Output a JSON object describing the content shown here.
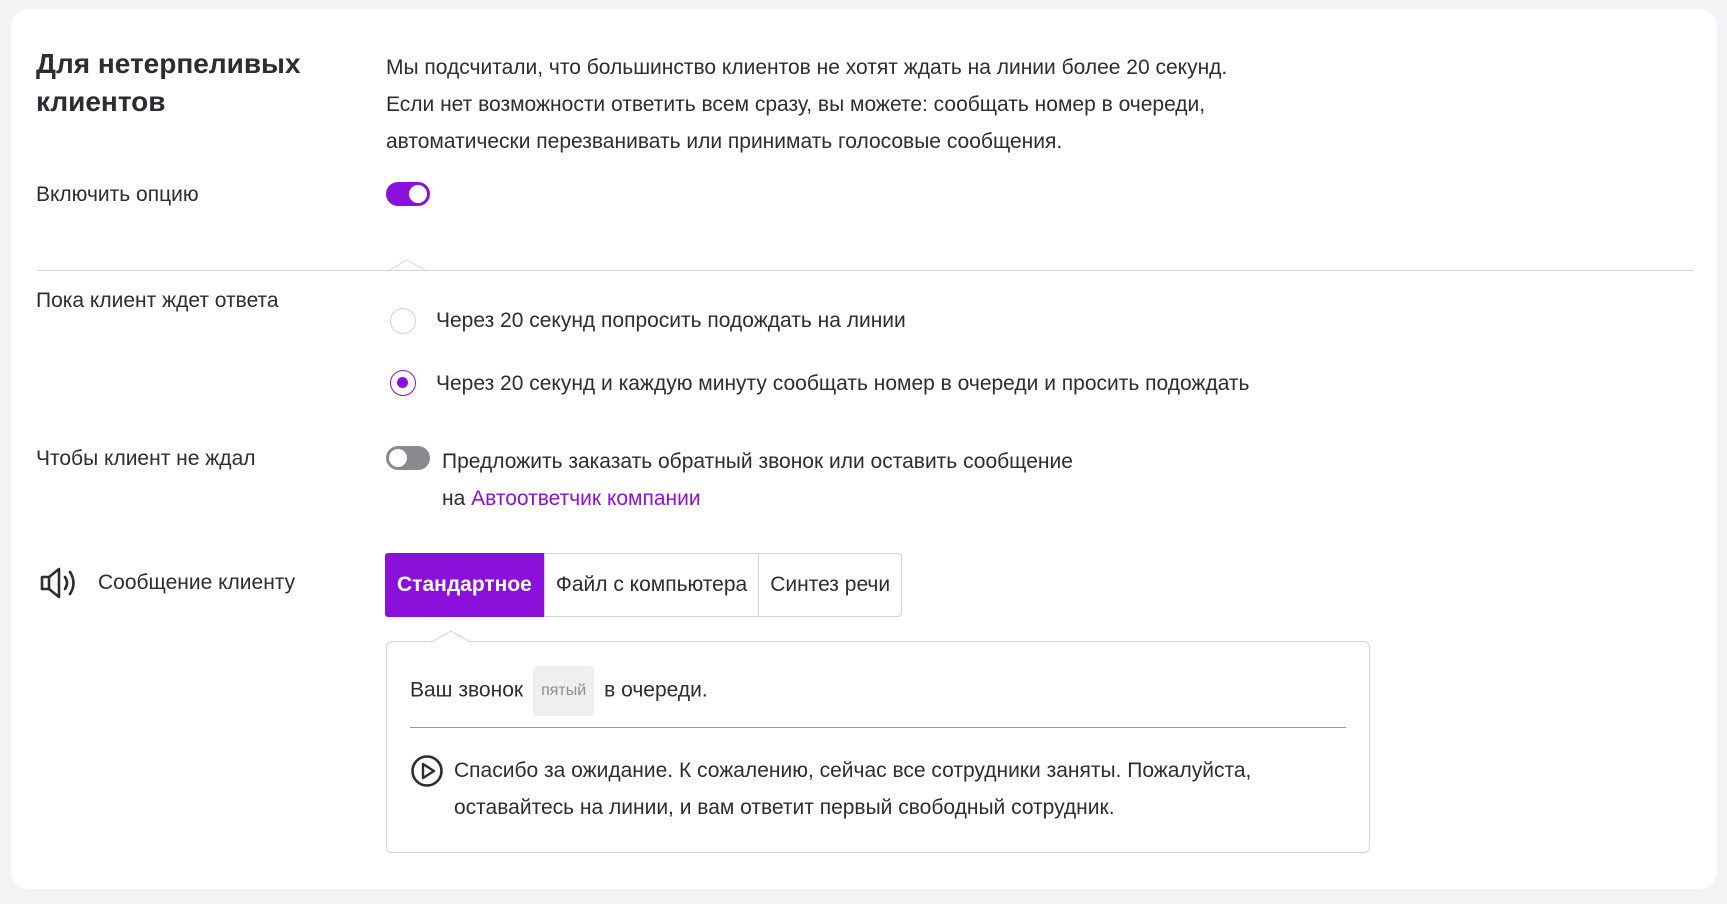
{
  "section": {
    "title": "Для нетерпеливых клиентов",
    "description_lines": [
      "Мы подсчитали, что большинство клиентов не хотят ждать на линии более 20 секунд.",
      "Если нет возможности ответить всем сразу, вы можете: сообщать номер в очереди,",
      "автоматически перезванивать или принимать голосовые сообщения."
    ]
  },
  "enable_option": {
    "label": "Включить опцию",
    "enabled": true
  },
  "while_waiting": {
    "label": "Пока клиент ждет ответа",
    "options": [
      {
        "label": "Через 20 секунд попросить подождать на линии",
        "selected": false
      },
      {
        "label": "Через 20 секунд и каждую минуту сообщать номер в очереди и просить подождать",
        "selected": true
      }
    ]
  },
  "no_wait": {
    "label": "Чтобы клиент не ждал",
    "enabled": false,
    "text_line1": "Предложить заказать обратный звонок или оставить сообщение",
    "text_prefix": "на",
    "link_text": "Автоответчик компании"
  },
  "client_message": {
    "label": "Сообщение клиенту",
    "icon": "speaker-icon",
    "tabs": [
      {
        "label": "Стандартное",
        "active": true
      },
      {
        "label": "Файл с компьютера",
        "active": false
      },
      {
        "label": "Синтез речи",
        "active": false
      }
    ],
    "queue_text_before": "Ваш звонок",
    "queue_position": "пятый",
    "queue_text_after": "в очереди.",
    "play_icon": "play-circle-icon",
    "message_lines": [
      "Спасибо за ожидание. К сожалению, сейчас все сотрудники заняты. Пожалуйста,",
      "оставайтесь на линии, и вам ответит первый свободный сотрудник."
    ]
  },
  "colors": {
    "accent": "#8b10d9",
    "toggle_off": "#8a8a8e",
    "background": "#f2f3f4"
  }
}
